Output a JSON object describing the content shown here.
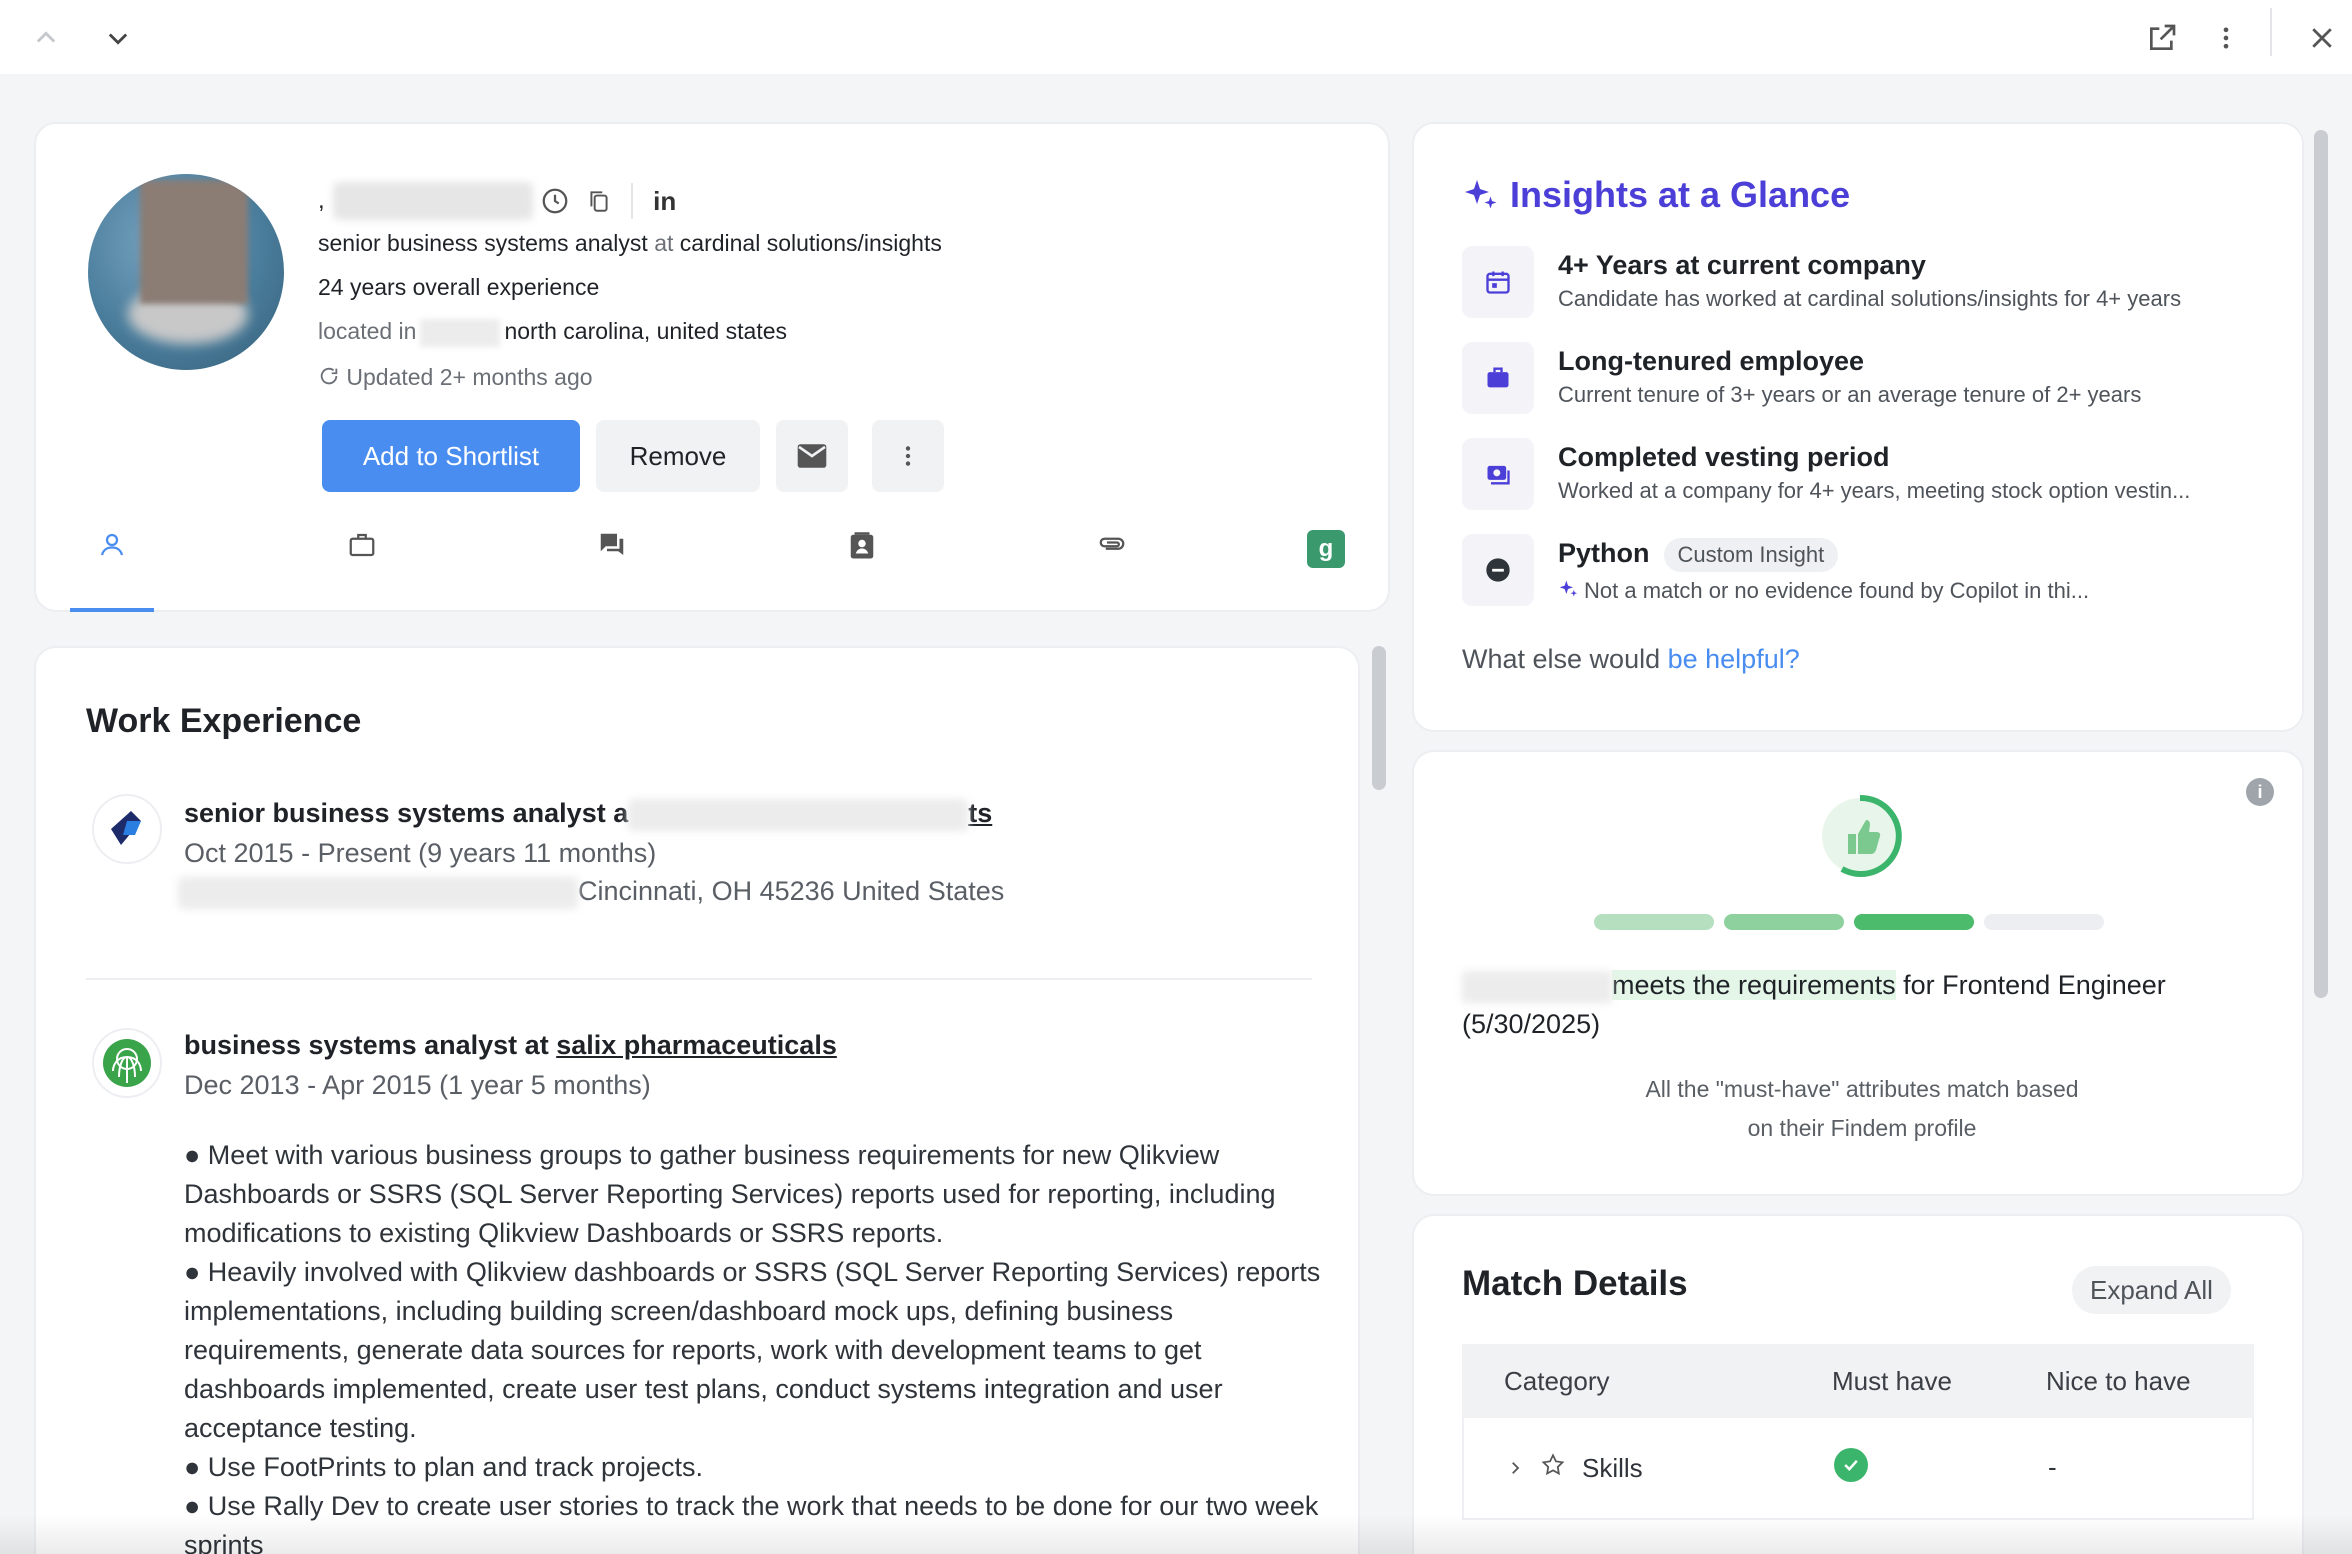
{
  "profile": {
    "title_line_prefix": "senior business systems analyst",
    "at_word": "at",
    "company": "cardinal solutions/insights",
    "experience": "24 years overall experience",
    "located_label": "located in",
    "location": "north carolina, united states",
    "updated": "Updated 2+ months ago",
    "add_shortlist": "Add to Shortlist",
    "remove": "Remove"
  },
  "tabs": [
    "profile-tab",
    "work-tab",
    "messages-tab",
    "contact-tab",
    "attachments-tab",
    "greenhouse-tab"
  ],
  "work": {
    "title": "Work Experience",
    "items": [
      {
        "title": "senior business systems analyst a",
        "company_tail": "ts",
        "dates": "Oct 2015 - Present (9 years 11 months)",
        "location": "Cincinnati, OH 45236 United States"
      },
      {
        "title": "business systems analyst at ",
        "company": "salix pharmaceuticals",
        "dates": "Dec 2013 - Apr 2015 (1 year 5 months)",
        "bullets": [
          "● Meet with various business groups to gather business requirements for new Qlikview Dashboards or SSRS (SQL Server Reporting Services) reports used for reporting, including modifications to existing Qlikview Dashboards or SSRS reports.",
          "● Heavily involved with Qlikview dashboards or SSRS (SQL Server Reporting Services) reports implementations, including building screen/dashboard mock ups, defining business requirements, generate data sources for reports, work with development teams to get dashboards implemented, create user test plans, conduct systems integration and user acceptance testing.",
          "● Use FootPrints to plan and track projects.",
          "● Use Rally Dev to create user stories to track the work that needs to be done for our two week sprints"
        ]
      }
    ]
  },
  "insights": {
    "title": "Insights at a Glance",
    "items": [
      {
        "heading": "4+ Years at current company",
        "sub": "Candidate has worked at cardinal solutions/insights for 4+ years"
      },
      {
        "heading": "Long-tenured employee",
        "sub": "Current tenure of 3+ years or an average tenure of 2+ years"
      },
      {
        "heading": "Completed vesting period",
        "sub": "Worked at a company for 4+ years, meeting stock option vestin..."
      },
      {
        "heading": "Python",
        "chip": "Custom Insight",
        "sub": "Not a match or no evidence found by Copilot in thi..."
      }
    ],
    "footer_prefix": "What else would ",
    "footer_link": "be helpful?"
  },
  "match": {
    "highlight": "meets the requirements",
    "rest": " for Frontend Engineer (5/30/2025)",
    "note_line1": "All the \"must-have\" attributes match based",
    "note_line2": "on their Findem profile",
    "segments_filled": 3,
    "segments_total": 4
  },
  "details": {
    "title": "Match Details",
    "expand": "Expand All",
    "columns": [
      "Category",
      "Must have",
      "Nice to have"
    ],
    "rows": [
      {
        "category": "Skills",
        "must": "check",
        "nice": "-"
      }
    ]
  },
  "colors": {
    "accent": "#4a8df0",
    "insight": "#4b3fd8",
    "success": "#3bb56b"
  }
}
